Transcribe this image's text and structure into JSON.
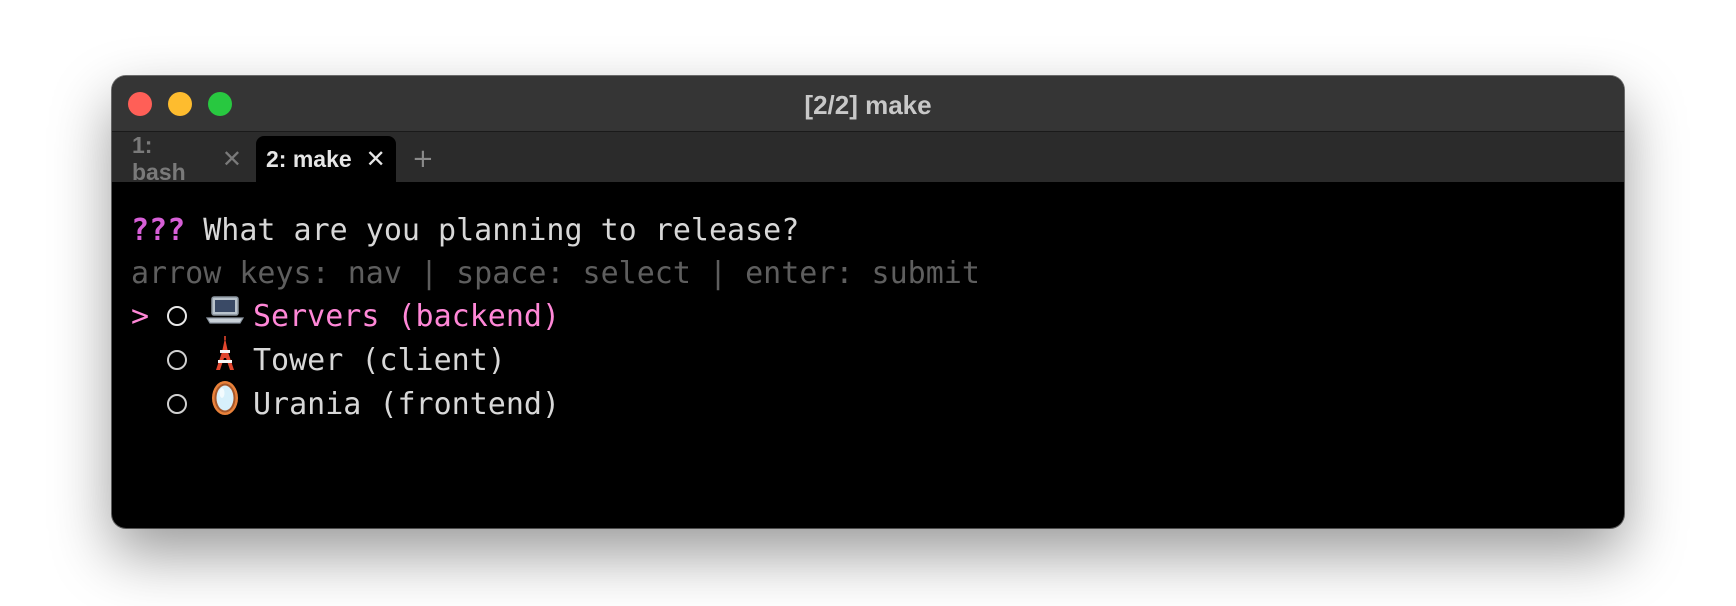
{
  "window": {
    "title": "[2/2] make"
  },
  "tabs": [
    {
      "label": "1: bash",
      "close": "✕"
    },
    {
      "label": "2: make",
      "close": "✕"
    }
  ],
  "new_tab_label": "+",
  "terminal": {
    "prompt_marker": "???",
    "question": "What are you planning to release?",
    "hint": "arrow keys: nav | space: select | enter: submit",
    "cursor": ">",
    "options": [
      {
        "icon": "laptop-icon",
        "label": "Servers (backend)",
        "highlighted": true
      },
      {
        "icon": "tokyo-tower-icon",
        "label": "Tower (client)",
        "highlighted": false
      },
      {
        "icon": "mirror-icon",
        "label": "Urania (frontend)",
        "highlighted": false
      }
    ]
  },
  "colors": {
    "prompt_marker": "#d75fd7",
    "highlight": "#ff87d7",
    "hint": "#5e5e5e",
    "traffic_close": "#ff5f57",
    "traffic_minimize": "#febc2e",
    "traffic_zoom": "#28c840"
  }
}
